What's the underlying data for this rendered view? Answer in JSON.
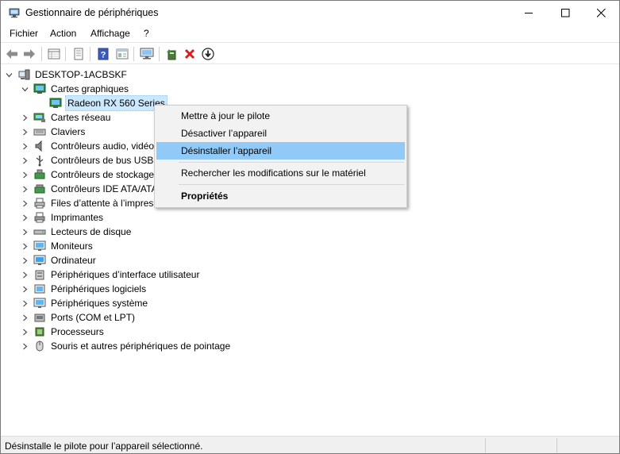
{
  "window": {
    "title": "Gestionnaire de périphériques"
  },
  "menu": {
    "items": [
      "Fichier",
      "Action",
      "Affichage",
      "?"
    ]
  },
  "toolbar": {
    "buttons": [
      "back-icon",
      "forward-icon",
      "properties-grid-icon",
      "update-driver-icon",
      "help-icon",
      "view-icon",
      "monitor-scan-icon",
      "add-driver-icon",
      "uninstall-icon",
      "download-icon"
    ]
  },
  "tree": {
    "root": "DESKTOP-1ACBSKF",
    "expanded_category": "Cartes graphiques",
    "selected_device": "Radeon RX 560 Series",
    "categories": [
      "Cartes réseau",
      "Claviers",
      "Contrôleurs audio, vidéo",
      "Contrôleurs de bus USB",
      "Contrôleurs de stockage",
      "Contrôleurs IDE ATA/ATA",
      "Files d’attente à l’impres",
      "Imprimantes",
      "Lecteurs de disque",
      "Moniteurs",
      "Ordinateur",
      "Périphériques d’interface utilisateur",
      "Périphériques logiciels",
      "Périphériques système",
      "Ports (COM et LPT)",
      "Processeurs",
      "Souris et autres périphériques de pointage"
    ]
  },
  "context_menu": {
    "update": "Mettre à jour le pilote",
    "disable": "Désactiver l’appareil",
    "uninstall": "Désinstaller l’appareil",
    "scan": "Rechercher les modifications sur le matériel",
    "properties": "Propriétés"
  },
  "status": {
    "text": "Désinstalle le pilote pour l’appareil sélectionné."
  },
  "colors": {
    "highlight": "#91c9f7",
    "selection": "#cce8ff",
    "menu_bg": "#f2f2f2"
  }
}
